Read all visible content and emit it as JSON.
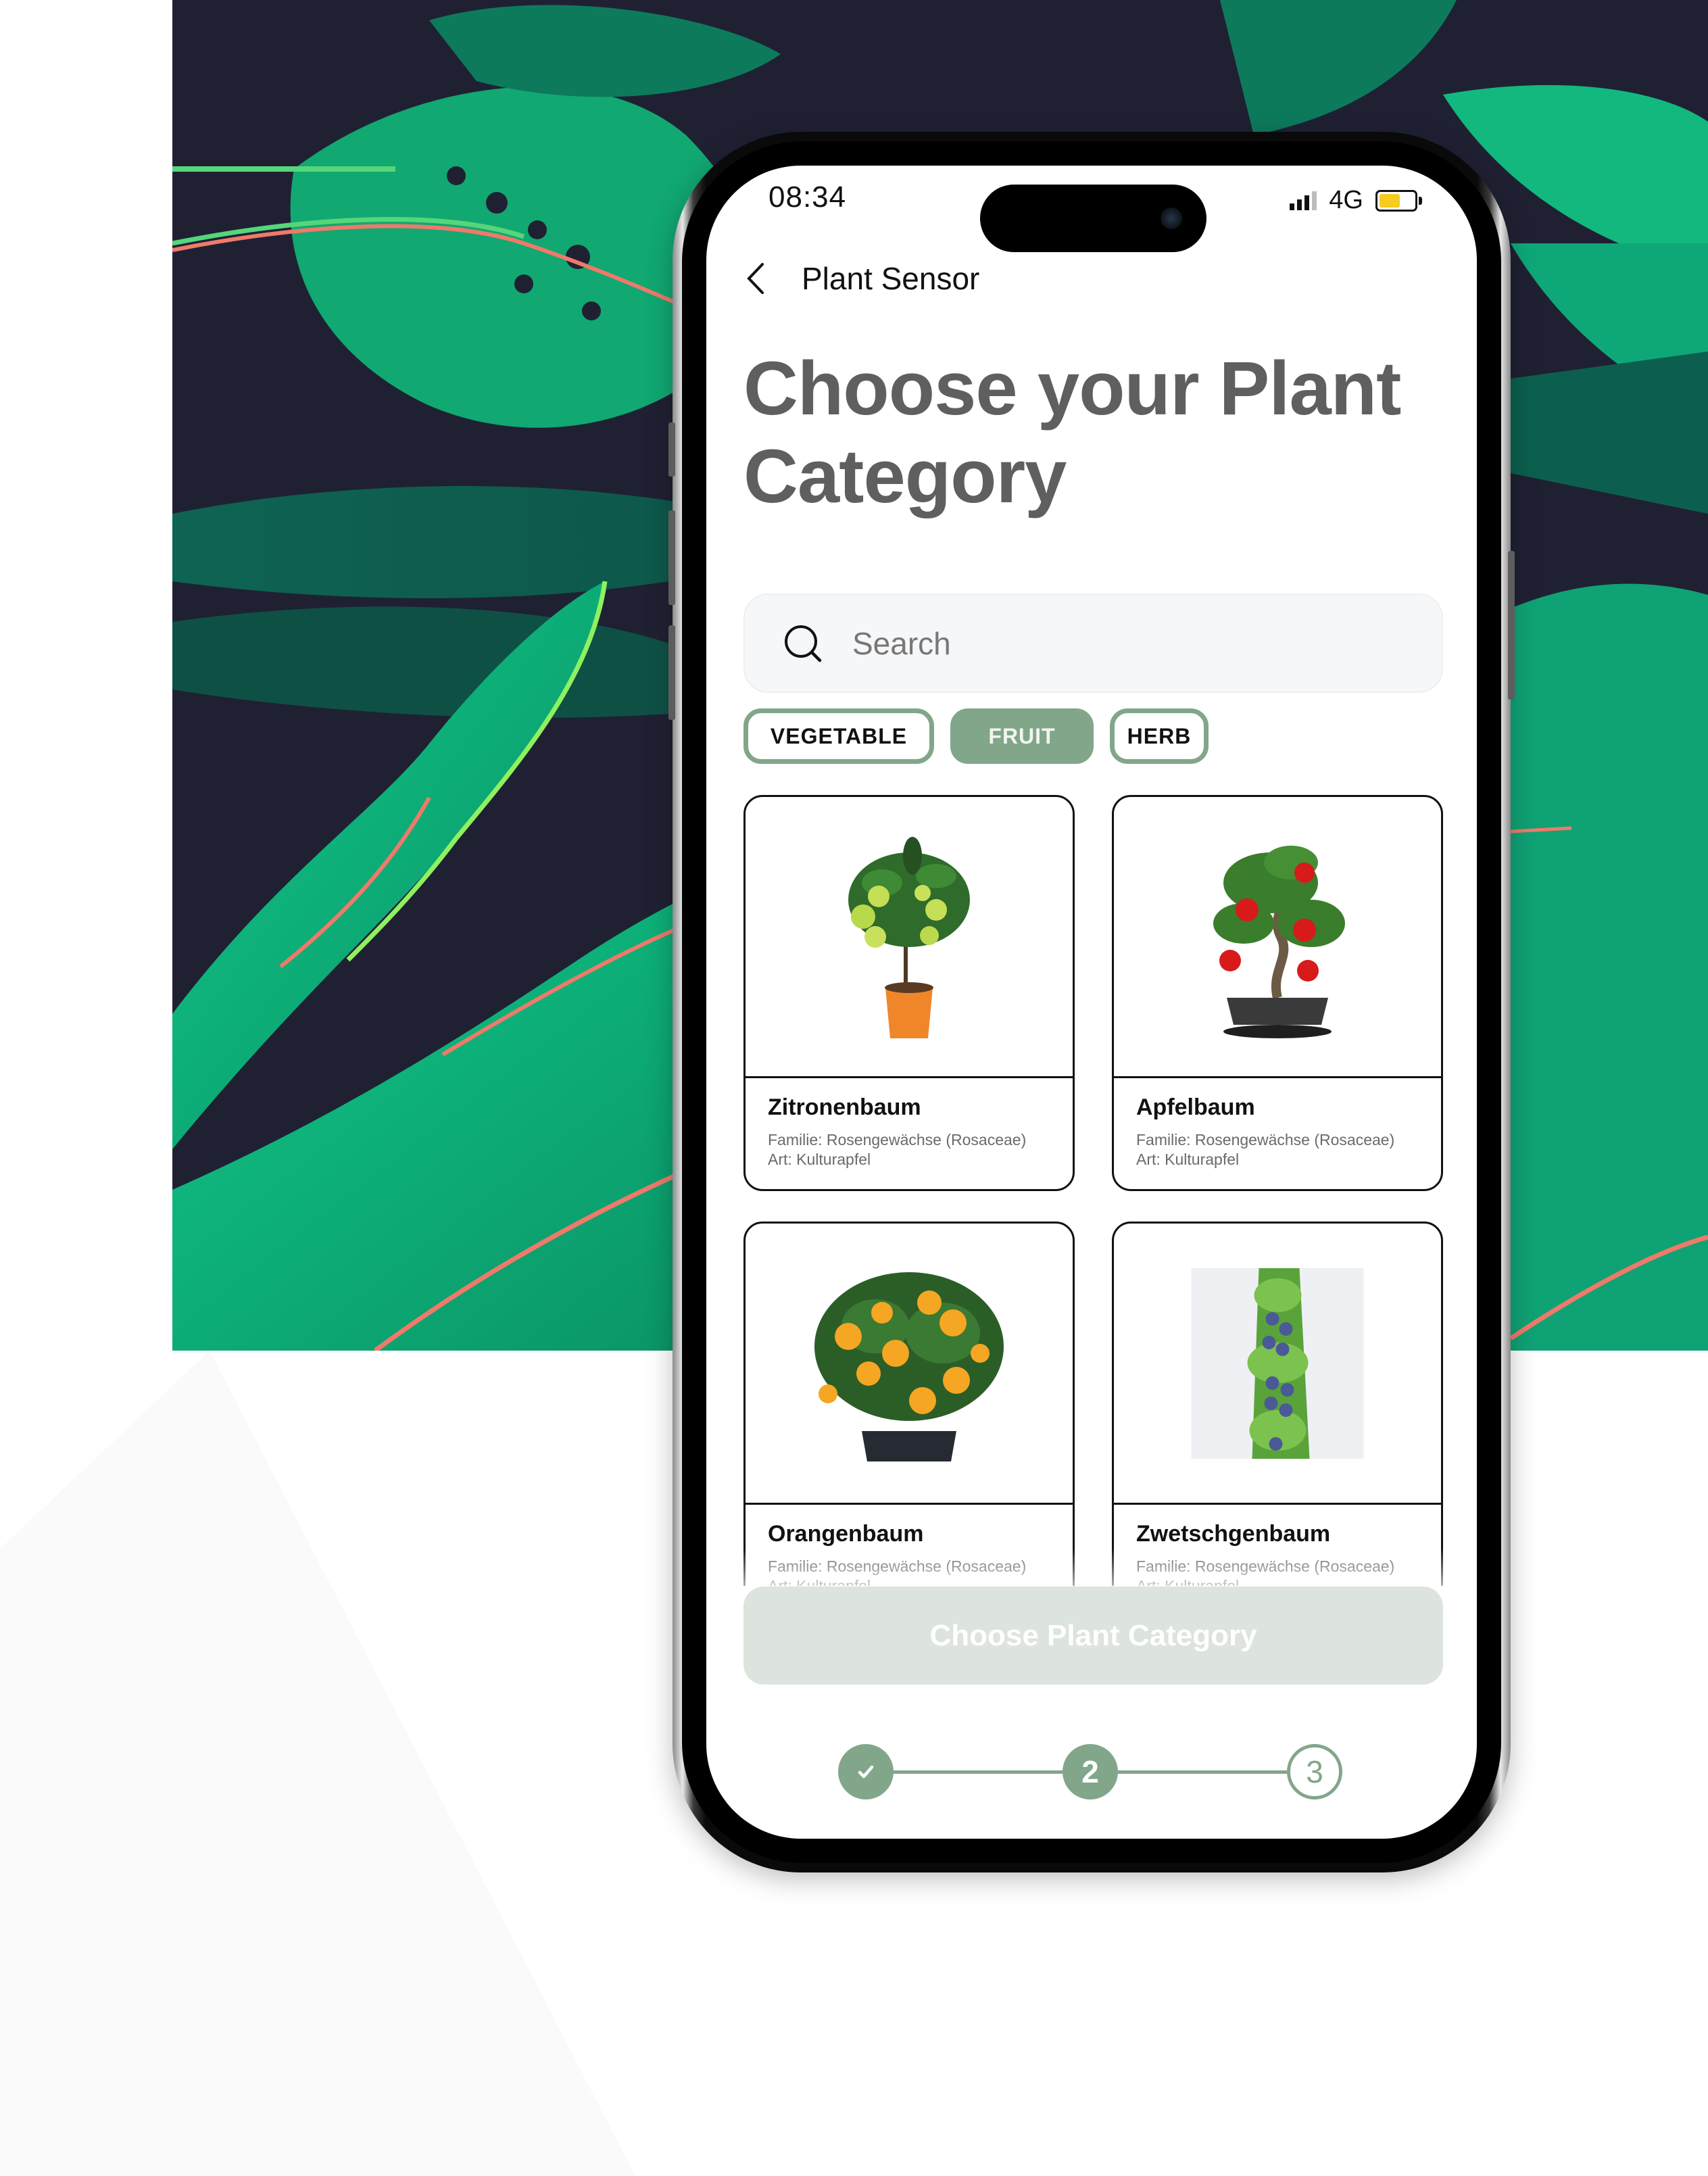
{
  "status_bar": {
    "time": "08:34",
    "network": "4G",
    "signal_bars_active": 3,
    "signal_bars_total": 4,
    "battery_level": 0.6,
    "battery_color": "#f5cc1f"
  },
  "nav": {
    "back_icon": "chevron-left-icon",
    "title": "Plant Sensor"
  },
  "page": {
    "title_line1": "Choose your Plant",
    "title_line2": "Category"
  },
  "search": {
    "icon": "search-icon",
    "placeholder": "Search",
    "value": ""
  },
  "filters": {
    "chips": [
      {
        "label": "VEGETABLE",
        "active": false
      },
      {
        "label": "FRUIT",
        "active": true
      },
      {
        "label": "HERB",
        "active": false
      }
    ]
  },
  "plants": [
    {
      "name": "Zitronenbaum",
      "family": "Familie: Rosengewächse (Rosaceae)",
      "species": "Art: Kulturapfel",
      "image": "lemon-tree-image"
    },
    {
      "name": "Apfelbaum",
      "family": "Familie: Rosengewächse (Rosaceae)",
      "species": "Art: Kulturapfel",
      "image": "apple-bonsai-image"
    },
    {
      "name": "Orangenbaum",
      "family": "Familie: Rosengewächse (Rosaceae)",
      "species": "Art: Kulturapfel",
      "image": "orange-tree-image"
    },
    {
      "name": "Zwetschgenbaum",
      "family": "Familie: Rosengewächse (Rosaceae)",
      "species": "Art: Kulturapfel",
      "image": "plum-column-tree-image"
    }
  ],
  "cta": {
    "label": "Choose Plant Category",
    "enabled": false
  },
  "stepper": {
    "steps": [
      {
        "label": "✓",
        "state": "done"
      },
      {
        "label": "2",
        "state": "current"
      },
      {
        "label": "3",
        "state": "todo"
      }
    ],
    "current_step": 2,
    "total_steps": 3
  },
  "colors": {
    "accent": "#82a68a",
    "title_gray": "#5f5f5f",
    "background_dark": "#1f2133",
    "leaf_green": "#0fbf82",
    "leaf_coral": "#ef7a6a"
  }
}
